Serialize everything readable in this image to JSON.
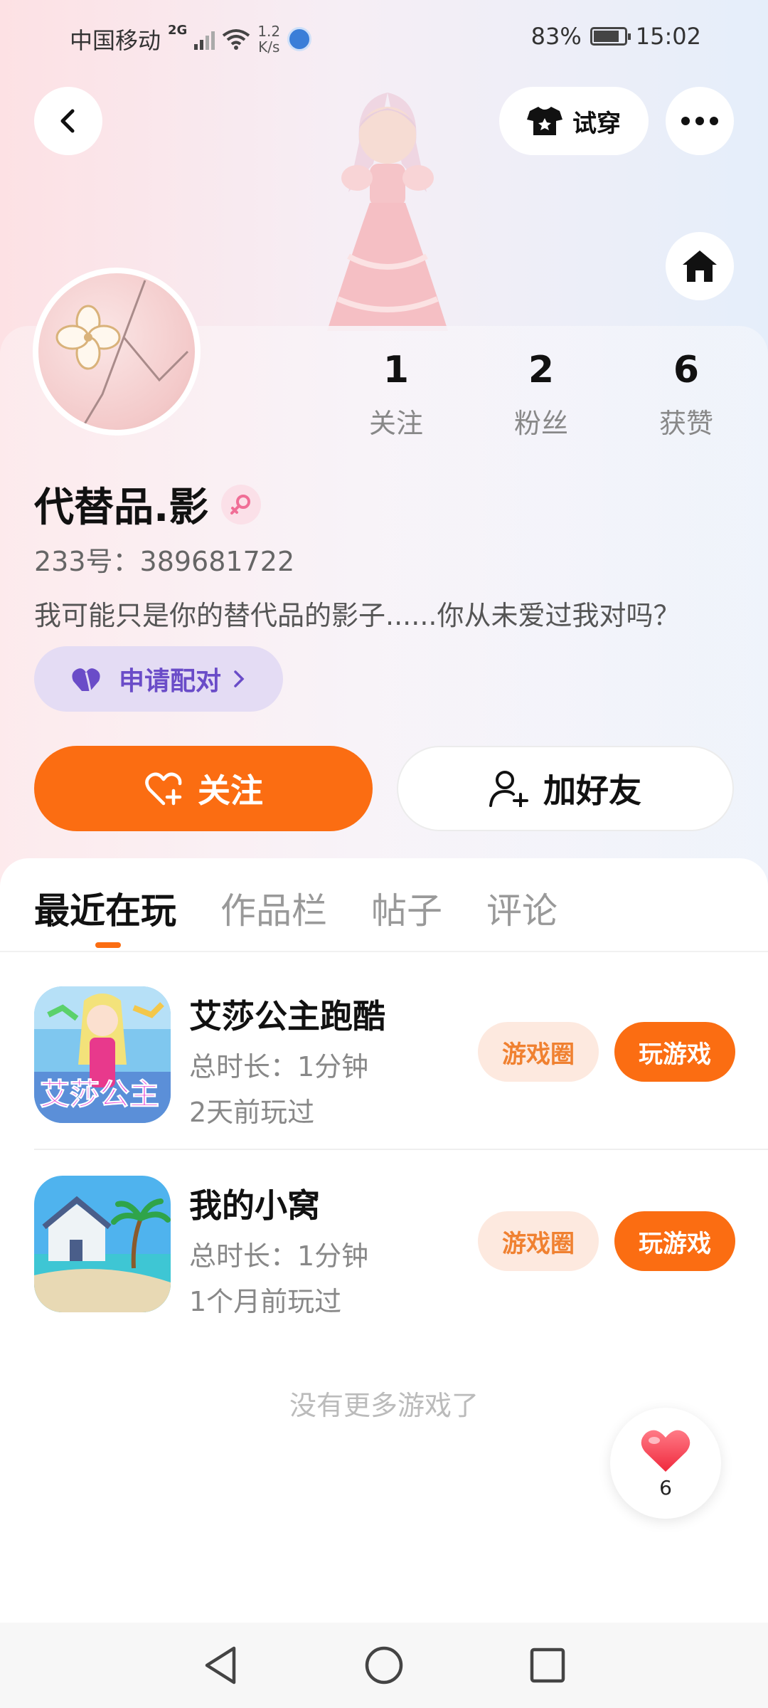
{
  "status_bar": {
    "carrier": "中国移动",
    "network": "2G",
    "net_speed_value": "1.2",
    "net_speed_unit": "K/s",
    "battery": "83%",
    "battery_level": 0.83,
    "time": "15:02"
  },
  "header": {
    "back_icon": "chevron-left-icon",
    "try_on_label": "试穿",
    "more_icon": "more-dots-icon",
    "home_icon": "home-icon"
  },
  "profile": {
    "name": "代替品.影",
    "gender_icon": "female-icon",
    "uid": "233号：389681722",
    "bio": "我可能只是你的替代品的影子......你从未爱过我对吗？",
    "pair_label": "申请配对",
    "stats": [
      {
        "value": "1",
        "label": "关注"
      },
      {
        "value": "2",
        "label": "粉丝"
      },
      {
        "value": "6",
        "label": "获赞"
      }
    ],
    "follow_label": "关注",
    "add_friend_label": "加好友"
  },
  "tabs": [
    "最近在玩",
    "作品栏",
    "帖子",
    "评论"
  ],
  "games": [
    {
      "title": "艾莎公主跑酷",
      "icon_text": "艾莎公主",
      "duration": "总时长：1分钟",
      "last_played": "2天前玩过",
      "circle_label": "游戏圈",
      "play_label": "玩游戏"
    },
    {
      "title": "我的小窝",
      "duration": "总时长：1分钟",
      "last_played": "1个月前玩过",
      "circle_label": "游戏圈",
      "play_label": "玩游戏"
    }
  ],
  "no_more": "没有更多游戏了",
  "like_fab": {
    "count": "6",
    "icon": "heart-icon"
  },
  "colors": {
    "accent": "#fb6d12",
    "pair": "#6a4cc8",
    "accent_soft": "#fde9df"
  }
}
